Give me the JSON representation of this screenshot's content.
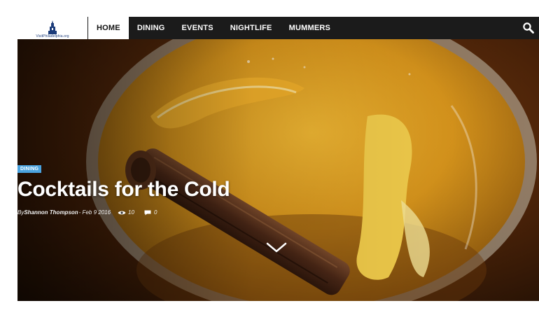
{
  "logo": {
    "text": "VisitPhiladelphia.org",
    "icon": "liberty-bell-tower-icon"
  },
  "nav": {
    "items": [
      {
        "label": "HOME",
        "active": true
      },
      {
        "label": "DINING",
        "active": false
      },
      {
        "label": "EVENTS",
        "active": false
      },
      {
        "label": "NIGHTLIFE",
        "active": false
      },
      {
        "label": "MUMMERS",
        "active": false
      }
    ],
    "search_icon": "search-icon"
  },
  "hero": {
    "category": "DINING",
    "title": "Cocktails for the Cold",
    "by": "By",
    "author": "Shannon Thompson",
    "date": "- Feb 9 2016",
    "views": "10",
    "comments": "0",
    "scroll_icon": "chevron-down-icon"
  },
  "colors": {
    "topbar": "#1b1b1b",
    "badge": "#4aa3df",
    "drink_amber": "#d99a1e",
    "lemon_peel": "#f0c23a"
  }
}
